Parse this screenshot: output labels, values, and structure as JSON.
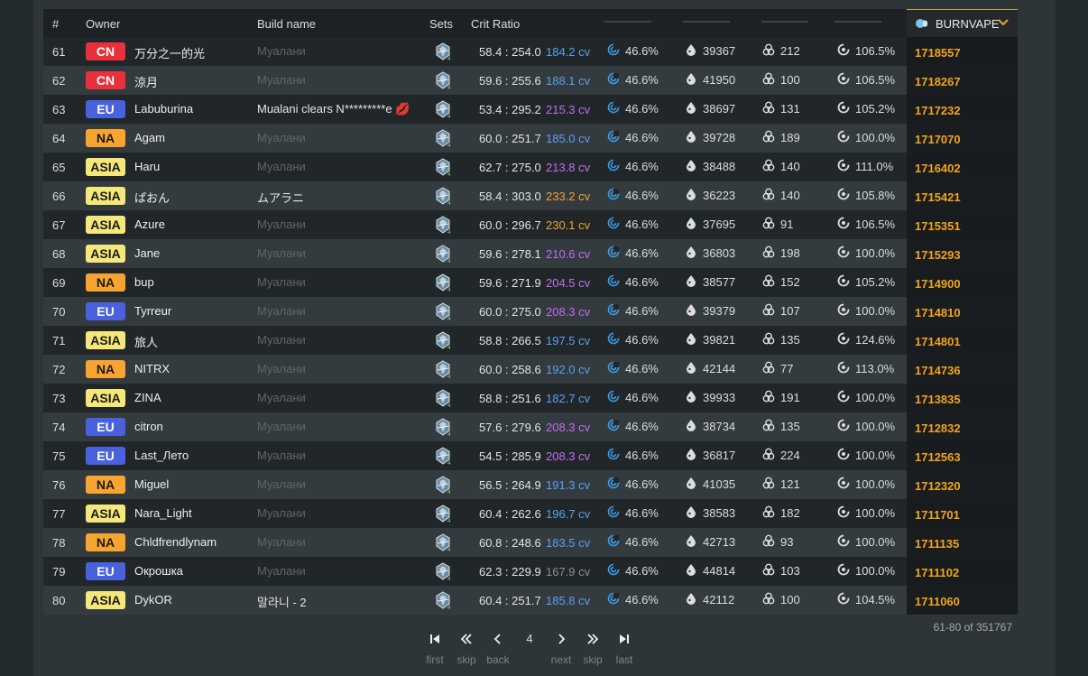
{
  "header": {
    "num": "#",
    "owner": "Owner",
    "build": "Build name",
    "sets": "Sets",
    "crit": "Crit Ratio",
    "sort_label": "BURNVAPE"
  },
  "region_colors": {
    "CN": {
      "bg": "#e8313b",
      "fg": "#ffffff"
    },
    "EU": {
      "bg": "#4a61dd",
      "fg": "#ffffff"
    },
    "NA": {
      "bg": "#f8a431",
      "fg": "#1a1a1a"
    },
    "ASIA": {
      "bg": "#f5e87a",
      "fg": "#1a1a1a"
    }
  },
  "cv_colors": {
    "blue": "#5b9ff0",
    "purple": "#c36cf0",
    "orange": "#f0a035",
    "gray": "#8d8d8d"
  },
  "rows": [
    {
      "num": "61",
      "region": "CN",
      "owner": "万分之一的光",
      "build": "Муалани",
      "build_real": false,
      "crit": "58.4 : 254.0",
      "cv": "184.2 cv",
      "cv_color": "blue",
      "er": "46.6%",
      "hp": "39367",
      "em": "212",
      "rec": "106.5%",
      "score": "1718557"
    },
    {
      "num": "62",
      "region": "CN",
      "owner": "涼月",
      "build": "Муалани",
      "build_real": false,
      "crit": "59.6 : 255.6",
      "cv": "188.1 cv",
      "cv_color": "blue",
      "er": "46.6%",
      "hp": "41950",
      "em": "100",
      "rec": "106.5%",
      "score": "1718267"
    },
    {
      "num": "63",
      "region": "EU",
      "owner": "Labuburina",
      "build": "Mualani clears N*********e 💋",
      "build_real": true,
      "crit": "53.4 : 295.2",
      "cv": "215.3 cv",
      "cv_color": "purple",
      "er": "46.6%",
      "hp": "38697",
      "em": "131",
      "rec": "105.2%",
      "score": "1717232"
    },
    {
      "num": "64",
      "region": "NA",
      "owner": "Agam",
      "build": "Муалани",
      "build_real": false,
      "crit": "60.0 : 251.7",
      "cv": "185.0 cv",
      "cv_color": "blue",
      "er": "46.6%",
      "hp": "39728",
      "em": "189",
      "rec": "100.0%",
      "score": "1717070"
    },
    {
      "num": "65",
      "region": "ASIA",
      "owner": "Haru",
      "build": "Муалани",
      "build_real": false,
      "crit": "62.7 : 275.0",
      "cv": "213.8 cv",
      "cv_color": "purple",
      "er": "46.6%",
      "hp": "38488",
      "em": "140",
      "rec": "111.0%",
      "score": "1716402"
    },
    {
      "num": "66",
      "region": "ASIA",
      "owner": "ぱおん",
      "build": "ムアラニ",
      "build_real": true,
      "crit": "58.4 : 303.0",
      "cv": "233.2 cv",
      "cv_color": "orange",
      "er": "46.6%",
      "hp": "36223",
      "em": "140",
      "rec": "105.8%",
      "score": "1715421"
    },
    {
      "num": "67",
      "region": "ASIA",
      "owner": "Azure",
      "build": "Муалани",
      "build_real": false,
      "crit": "60.0 : 296.7",
      "cv": "230.1 cv",
      "cv_color": "orange",
      "er": "46.6%",
      "hp": "37695",
      "em": "91",
      "rec": "106.5%",
      "score": "1715351"
    },
    {
      "num": "68",
      "region": "ASIA",
      "owner": "Jane",
      "build": "Муалани",
      "build_real": false,
      "crit": "59.6 : 278.1",
      "cv": "210.6 cv",
      "cv_color": "purple",
      "er": "46.6%",
      "hp": "36803",
      "em": "198",
      "rec": "100.0%",
      "score": "1715293"
    },
    {
      "num": "69",
      "region": "NA",
      "owner": "bup",
      "build": "Муалани",
      "build_real": false,
      "crit": "59.6 : 271.9",
      "cv": "204.5 cv",
      "cv_color": "purple",
      "er": "46.6%",
      "hp": "38577",
      "em": "152",
      "rec": "105.2%",
      "score": "1714900"
    },
    {
      "num": "70",
      "region": "EU",
      "owner": "Tyrreur",
      "build": "Муалани",
      "build_real": false,
      "crit": "60.0 : 275.0",
      "cv": "208.3 cv",
      "cv_color": "purple",
      "er": "46.6%",
      "hp": "39379",
      "em": "107",
      "rec": "100.0%",
      "score": "1714810"
    },
    {
      "num": "71",
      "region": "ASIA",
      "owner": "旅人",
      "build": "Муалани",
      "build_real": false,
      "crit": "58.8 : 266.5",
      "cv": "197.5 cv",
      "cv_color": "blue",
      "er": "46.6%",
      "hp": "39821",
      "em": "135",
      "rec": "124.6%",
      "score": "1714801"
    },
    {
      "num": "72",
      "region": "NA",
      "owner": "NITRX",
      "build": "Муалани",
      "build_real": false,
      "crit": "60.0 : 258.6",
      "cv": "192.0 cv",
      "cv_color": "blue",
      "er": "46.6%",
      "hp": "42144",
      "em": "77",
      "rec": "113.0%",
      "score": "1714736"
    },
    {
      "num": "73",
      "region": "ASIA",
      "owner": "ZINA",
      "build": "Муалани",
      "build_real": false,
      "crit": "58.8 : 251.6",
      "cv": "182.7 cv",
      "cv_color": "blue",
      "er": "46.6%",
      "hp": "39933",
      "em": "191",
      "rec": "100.0%",
      "score": "1713835"
    },
    {
      "num": "74",
      "region": "EU",
      "owner": "citron",
      "build": "Муалани",
      "build_real": false,
      "crit": "57.6 : 279.6",
      "cv": "208.3 cv",
      "cv_color": "purple",
      "er": "46.6%",
      "hp": "38734",
      "em": "135",
      "rec": "100.0%",
      "score": "1712832"
    },
    {
      "num": "75",
      "region": "EU",
      "owner": "Last_Лето",
      "build": "Муалани",
      "build_real": false,
      "crit": "54.5 : 285.9",
      "cv": "208.3 cv",
      "cv_color": "purple",
      "er": "46.6%",
      "hp": "36817",
      "em": "224",
      "rec": "100.0%",
      "score": "1712563"
    },
    {
      "num": "76",
      "region": "NA",
      "owner": "Miguel",
      "build": "Муалани",
      "build_real": false,
      "crit": "56.5 : 264.9",
      "cv": "191.3 cv",
      "cv_color": "blue",
      "er": "46.6%",
      "hp": "41035",
      "em": "121",
      "rec": "100.0%",
      "score": "1712320"
    },
    {
      "num": "77",
      "region": "ASIA",
      "owner": "Nara_Light",
      "build": "Муалани",
      "build_real": false,
      "crit": "60.4 : 262.6",
      "cv": "196.7 cv",
      "cv_color": "blue",
      "er": "46.6%",
      "hp": "38583",
      "em": "182",
      "rec": "100.0%",
      "score": "1711701"
    },
    {
      "num": "78",
      "region": "NA",
      "owner": "Chldfrendlynam",
      "build": "Муалани",
      "build_real": false,
      "crit": "60.8 : 248.6",
      "cv": "183.5 cv",
      "cv_color": "blue",
      "er": "46.6%",
      "hp": "42713",
      "em": "93",
      "rec": "100.0%",
      "score": "1711135"
    },
    {
      "num": "79",
      "region": "EU",
      "owner": "Окрошка",
      "build": "Муалани",
      "build_real": false,
      "crit": "62.3 : 229.9",
      "cv": "167.9 cv",
      "cv_color": "gray",
      "er": "46.6%",
      "hp": "44814",
      "em": "103",
      "rec": "100.0%",
      "score": "1711102"
    },
    {
      "num": "80",
      "region": "ASIA",
      "owner": "DykOR",
      "build": "말라니 - 2",
      "build_real": true,
      "crit": "60.4 : 251.7",
      "cv": "185.8 cv",
      "cv_color": "blue",
      "er": "46.6%",
      "hp": "42112",
      "em": "100",
      "rec": "104.5%",
      "score": "1711060"
    }
  ],
  "icons": {
    "energy": "energy-recharge-icon",
    "hp": "hp-drop-icon",
    "em": "elemental-mastery-icon",
    "rec": "healing-icon",
    "sort": "vape-icon"
  },
  "pagination": {
    "range": "61-80 of 351767",
    "current_page": "4",
    "first": "first",
    "skip_back": "skip",
    "back": "back",
    "next": "next",
    "skip_fwd": "skip",
    "last": "last"
  }
}
